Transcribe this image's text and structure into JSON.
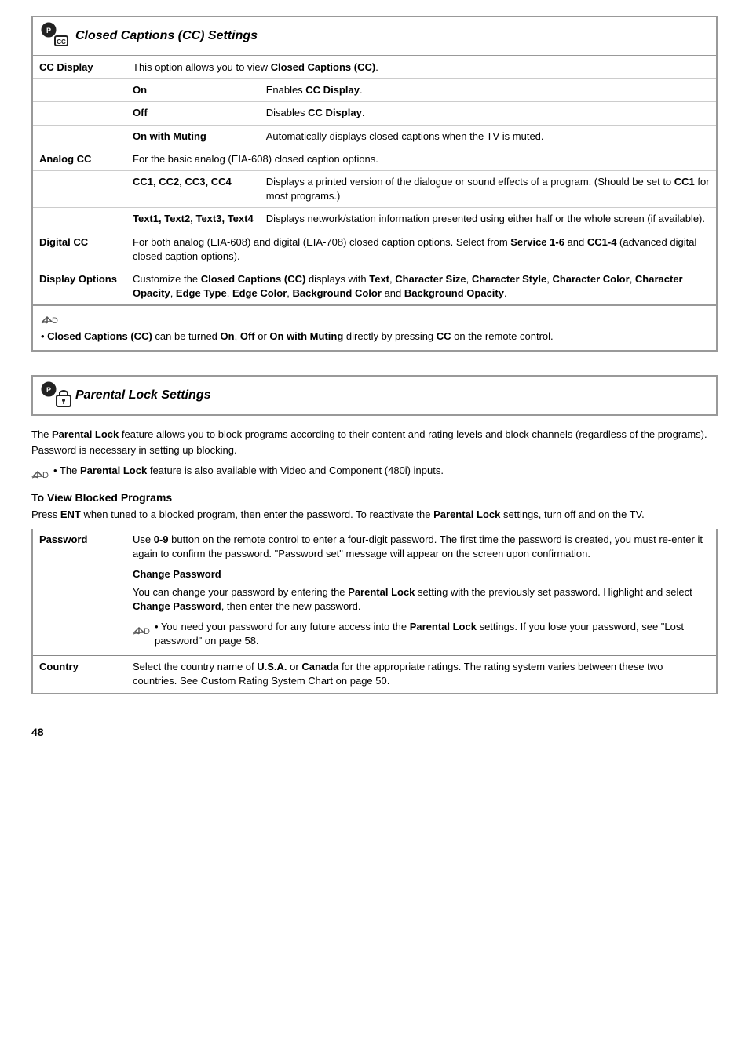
{
  "cc_section": {
    "title": "Closed Captions (CC) Settings",
    "rows": [
      {
        "label": "CC Display",
        "description": "This option allows you to view <b>Closed Captions (CC)</b>.",
        "options": [
          {
            "name": "On",
            "desc": "Enables <b>CC Display</b>."
          },
          {
            "name": "Off",
            "desc": "Disables <b>CC Display</b>."
          },
          {
            "name": "On with Muting",
            "desc": "Automatically displays closed captions when the TV is muted."
          }
        ]
      },
      {
        "label": "Analog CC",
        "description": "For the basic analog (EIA-608) closed caption options.",
        "options": [
          {
            "name": "CC1, CC2, CC3, CC4",
            "desc": "Displays a printed version of the dialogue or sound effects of a program. (Should be set to <b>CC1</b> for most programs.)"
          },
          {
            "name": "Text1, Text2, Text3, Text4",
            "desc": "Displays network/station information presented using either half or the whole screen (if available)."
          }
        ]
      },
      {
        "label": "Digital CC",
        "description": "For both analog (EIA-608) and digital (EIA-708) closed caption options. Select from <b>Service 1-6</b> and <b>CC1-4</b> (advanced digital closed caption options).",
        "options": []
      },
      {
        "label": "Display Options",
        "description": "Customize the <b>Closed Captions (CC)</b> displays with <b>Text</b>, <b>Character Size</b>, <b>Character Style</b>, <b>Character Color</b>, <b>Character Opacity</b>, <b>Edge Type</b>, <b>Edge Color</b>, <b>Background Color</b> and <b>Background Opacity</b>.",
        "options": []
      }
    ],
    "note": "• <b>Closed Captions (CC)</b> can be turned <b>On</b>, <b>Off</b> or <b>On with Muting</b> directly by pressing <b>CC</b> on the remote control."
  },
  "parental_section": {
    "title": "Parental Lock Settings",
    "intro": "The <b>Parental Lock</b> feature allows you to block programs according to their content and rating levels and block channels (regardless of the programs). Password is necessary in setting up blocking.",
    "note1": "• The <b>Parental Lock</b> feature is also available with Video and Component (480i) inputs.",
    "subheading": "To View Blocked Programs",
    "blocked_para": "Press <b>ENT</b> when tuned to a blocked program, then enter the password. To reactivate the <b>Parental Lock</b> settings, turn off and on the TV.",
    "rows": [
      {
        "label": "Password",
        "description": "Use <b>0-9</b> button on the remote control to enter a four-digit password. The first time the password is created, you must re-enter it again to confirm the password. \"Password set\" message will appear on the screen upon confirmation.",
        "sub_heading": "Change Password",
        "sub_desc": "You can change your password by entering the <b>Parental Lock</b> setting with the previously set password. Highlight and select <b>Change Password</b>, then enter the new password.",
        "note": "• You need your password for any future access into the <b>Parental Lock</b> settings. If you lose your password, see \"Lost password\" on page 58."
      },
      {
        "label": "Country",
        "description": "Select the country name of <b>U.S.A.</b> or <b>Canada</b> for the appropriate ratings. The rating system varies between these two countries. See Custom Rating System Chart on page 50."
      }
    ]
  },
  "page_number": "48"
}
